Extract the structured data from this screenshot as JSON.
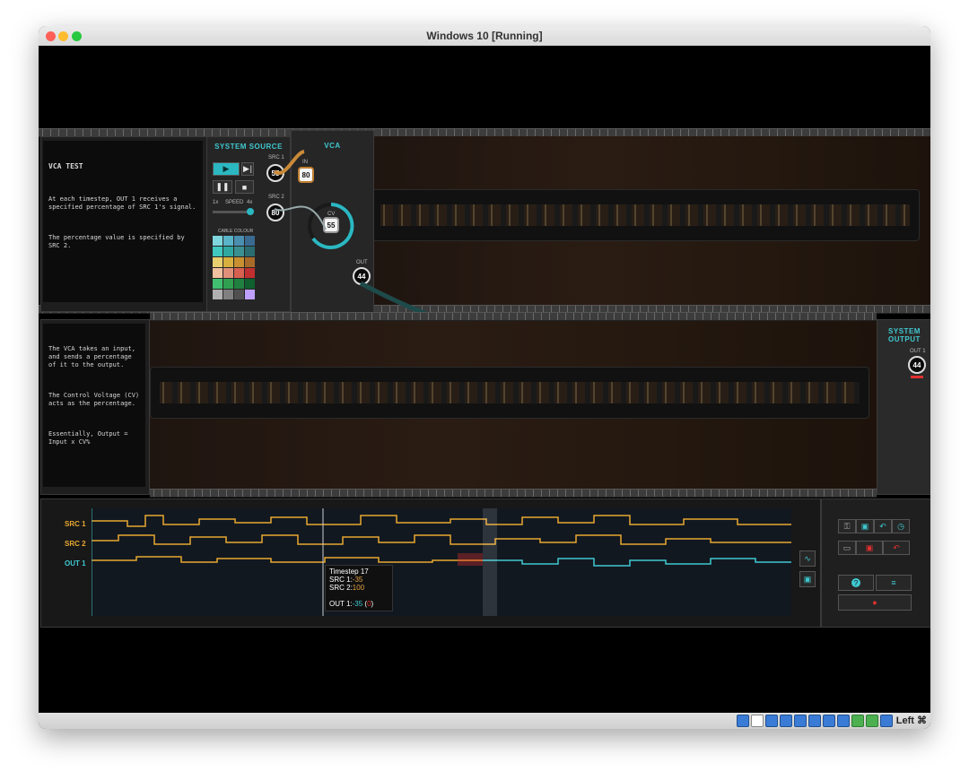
{
  "window": {
    "title": "Windows 10 [Running]"
  },
  "statusbar": {
    "host_key": "Left ⌘"
  },
  "level": {
    "title": "VCA TEST",
    "paragraphs": [
      "At each timestep, OUT 1 receives a specified percentage of SRC 1's signal.",
      "The percentage value is specified by SRC 2."
    ]
  },
  "help": {
    "paragraphs": [
      "The VCA takes an input, and sends a percentage of it to the output.",
      "The Control Voltage (CV) acts as the percentage.",
      "Essentially, Output = Input x CV%"
    ]
  },
  "system_source": {
    "heading": "SYSTEM SOURCE",
    "src1_label": "SRC 1",
    "src1_value": "55",
    "src2_label": "SRC 2",
    "src2_value": "80",
    "speed_label": "SPEED",
    "speed_min": "1x",
    "speed_max": "4x",
    "cable_colour_label": "CABLE COLOUR",
    "swatches": [
      "#7fd6dc",
      "#5ab4c8",
      "#4a8fb0",
      "#3a6a90",
      "#41c8c0",
      "#2fa8a0",
      "#3a9090",
      "#2a6c70",
      "#e8d070",
      "#d8b040",
      "#c89030",
      "#a86a28",
      "#f0c0a0",
      "#e0907a",
      "#d86050",
      "#c03030",
      "#40c070",
      "#30a050",
      "#208040",
      "#106030",
      "#b0b0b0",
      "#808080",
      "#505050",
      "#c0a0ff"
    ]
  },
  "vca": {
    "heading": "VCA",
    "in_label": "IN",
    "in_value": "80",
    "cv_label": "CV",
    "cv_value": "55",
    "out_label": "OUT",
    "out_value": "44"
  },
  "system_output": {
    "heading": "SYSTEM OUTPUT",
    "out1_label": "OUT 1",
    "out1_value": "44"
  },
  "timeline": {
    "channels": [
      "SRC 1",
      "SRC 2",
      "OUT 1"
    ],
    "tooltip": {
      "timestep_label": "Timestep",
      "timestep_value": "17",
      "src1_label": "SRC 1:",
      "src1_value": "-35",
      "src2_label": "SRC 2:",
      "src2_value": "100",
      "out1_label": "OUT 1:",
      "out1_value": "-35",
      "out1_expected": "0"
    }
  },
  "controls": {
    "lock_icon": "lock-icon",
    "save_icon": "save-icon",
    "undo_icon": "undo-icon",
    "clock_icon": "clock-icon",
    "trash_icon": "trash-icon",
    "help_label": "?",
    "menu_label": "≡",
    "record_label": "●"
  },
  "colors": {
    "accent": "#3fc8d0",
    "src": "#e8a830",
    "error": "#e23030"
  }
}
